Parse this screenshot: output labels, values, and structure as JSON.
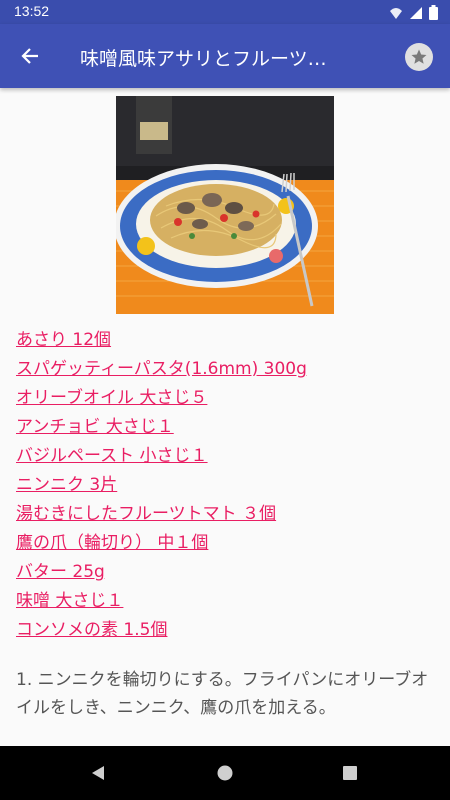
{
  "status_bar": {
    "time": "13:52"
  },
  "app_bar": {
    "title": "味噌風味アサリとフルーツ…"
  },
  "photo": {
    "icon": "pasta-dish-photo"
  },
  "ingredients": [
    "あさり 12個",
    "スパゲッティーパスタ(1.6mm) 300g",
    "オリーブオイル 大さじ５",
    "アンチョビ 大さじ１",
    "バジルペースト 小さじ１",
    "ニンニク 3片",
    "湯むきにしたフルーツトマト ３個",
    "鷹の爪（輪切り） 中１個",
    "バター 25g",
    "味噌 大さじ１",
    "コンソメの素 1.5個"
  ],
  "steps": [
    "1. ニンニクを輪切りにする。フライパンにオリーブオイルをしき、ニンニク、鷹の爪を加える。"
  ],
  "colors": {
    "primary": "#3f51b5",
    "status": "#3a4dad",
    "link": "#e91e63"
  }
}
